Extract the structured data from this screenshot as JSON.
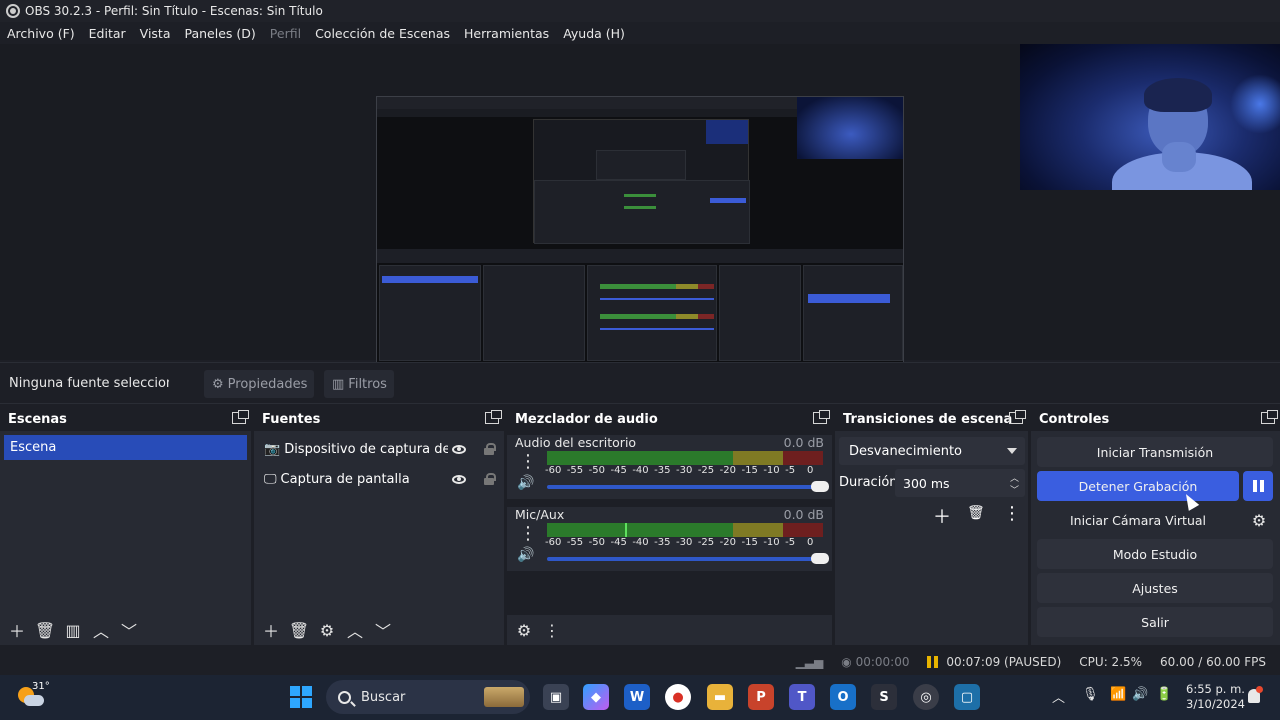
{
  "window": {
    "title": "OBS 30.2.3 - Perfil: Sin Título - Escenas: Sin Título"
  },
  "menu": [
    {
      "label": "Archivo (F)",
      "disabled": false
    },
    {
      "label": "Editar",
      "disabled": false
    },
    {
      "label": "Vista",
      "disabled": false
    },
    {
      "label": "Paneles (D)",
      "disabled": false
    },
    {
      "label": "Perfil",
      "disabled": true
    },
    {
      "label": "Colección de Escenas",
      "disabled": false
    },
    {
      "label": "Herramientas",
      "disabled": false
    },
    {
      "label": "Ayuda (H)",
      "disabled": false
    }
  ],
  "propbar": {
    "no_selection": "Ninguna fuente seleccionada",
    "properties_label": "Propiedades",
    "filters_label": "Filtros"
  },
  "scenes": {
    "title": "Escenas",
    "items": [
      "Escena"
    ]
  },
  "sources": {
    "title": "Fuentes",
    "items": [
      {
        "name": "Dispositivo de captura de video",
        "icon": "camera-icon"
      },
      {
        "name": "Captura de pantalla",
        "icon": "monitor-icon"
      }
    ]
  },
  "mixer": {
    "title": "Mezclador de audio",
    "ticks": [
      "-60",
      "-55",
      "-50",
      "-45",
      "-40",
      "-35",
      "-30",
      "-25",
      "-20",
      "-15",
      "-10",
      "-5",
      "0"
    ],
    "channels": [
      {
        "name": "Audio del escritorio",
        "db": "0.0 dB",
        "level": 0.0
      },
      {
        "name": "Mic/Aux",
        "db": "0.0 dB",
        "level": 0.28
      }
    ]
  },
  "transitions": {
    "title": "Transiciones de escena",
    "selected": "Desvanecimiento",
    "duration_label": "Duración",
    "duration_value": "300 ms"
  },
  "controls": {
    "title": "Controles",
    "start_stream": "Iniciar Transmisión",
    "stop_recording": "Detener Grabación",
    "start_virtual_cam": "Iniciar Cámara Virtual",
    "studio_mode": "Modo Estudio",
    "settings": "Ajustes",
    "exit": "Salir"
  },
  "status": {
    "stream_time": "00:00:00",
    "rec_time": "00:07:09 (PAUSED)",
    "cpu": "CPU: 2.5%",
    "fps": "60.00 / 60.00 FPS"
  },
  "taskbar": {
    "temperature": "31°",
    "search_placeholder": "Buscar",
    "time": "6:55 p. m.",
    "date": "3/10/2024"
  },
  "colors": {
    "accent": "#3a5ee0",
    "selection": "#284cb8",
    "paused": "#e8b400"
  }
}
